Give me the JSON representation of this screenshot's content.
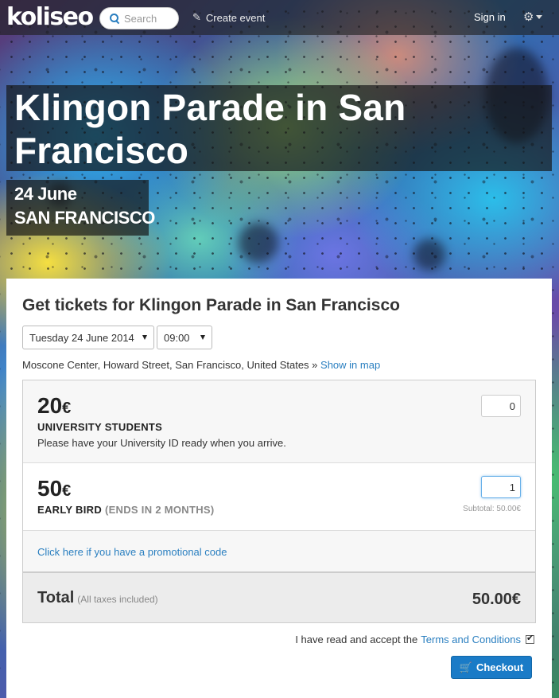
{
  "navbar": {
    "logo": "koliseo",
    "search_placeholder": "Search",
    "create_event": "Create event",
    "sign_in": "Sign in"
  },
  "hero": {
    "title": "Klingon Parade in San Francisco",
    "date": "24 June",
    "city": "SAN FRANCISCO"
  },
  "panel": {
    "title": "Get tickets for Klingon Parade in San Francisco",
    "date_select": "Tuesday 24 June 2014",
    "time_select": "09:00",
    "address": "Moscone Center, Howard Street, San Francisco, United States »",
    "show_map": "Show in map"
  },
  "tickets": [
    {
      "price": "20",
      "currency": "€",
      "name": "UNIVERSITY STUDENTS",
      "description": "Please have your University ID ready when you arrive.",
      "quantity": "0"
    },
    {
      "price": "50",
      "currency": "€",
      "name": "EARLY BIRD",
      "name_note": "(ENDS IN 2 MONTHS)",
      "quantity": "1",
      "subtotal": "Subtotal: 50.00€"
    }
  ],
  "promo_link": "Click here if you have a promotional code",
  "total": {
    "label": "Total",
    "note": "(All taxes included)",
    "value": "50.00€"
  },
  "terms": {
    "text": "I have read and accept the",
    "link": "Terms and Conditions",
    "checked": true
  },
  "checkout_label": "Checkout",
  "colors": {
    "link": "#2a7fc0",
    "button": "#1a7bc7"
  }
}
